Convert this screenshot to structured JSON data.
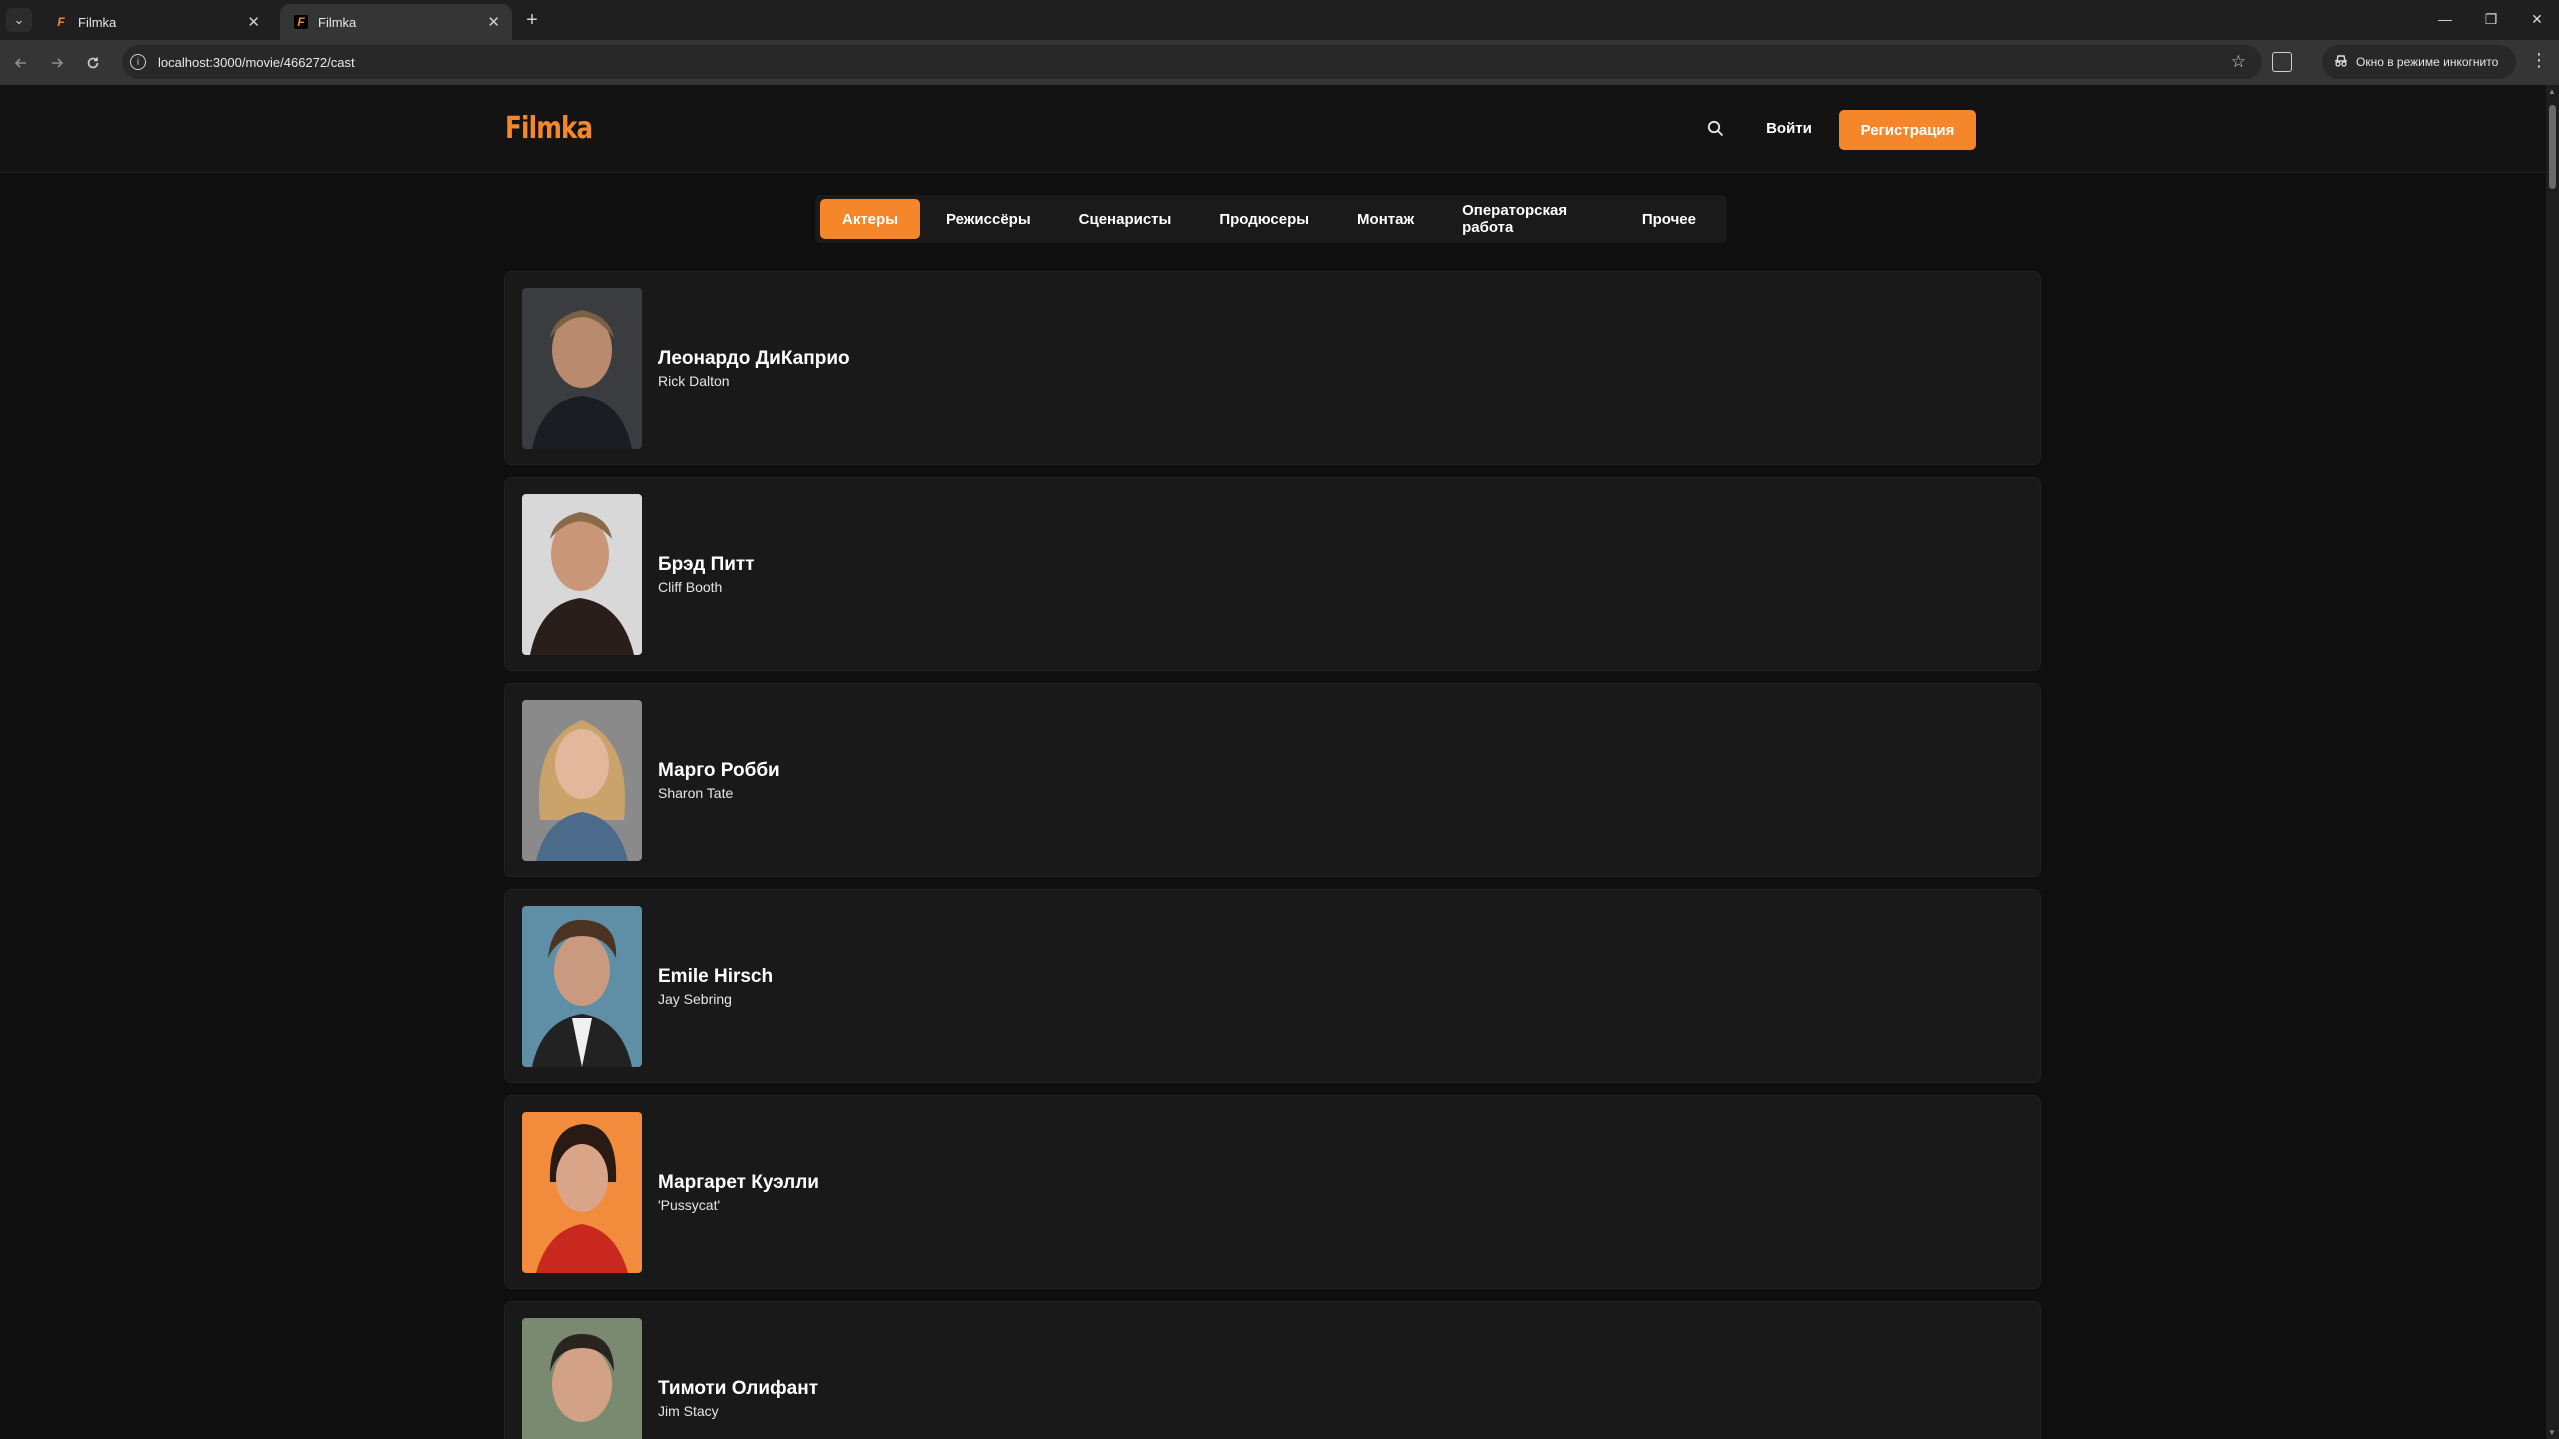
{
  "browser": {
    "tabs": [
      {
        "title": "Filmka",
        "favicon": "F",
        "active": false
      },
      {
        "title": "Filmka",
        "favicon": "F",
        "active": true
      }
    ],
    "url": "localhost:3000/movie/466272/cast",
    "incognito_label": "Окно в режиме инкогнито",
    "new_tab_symbol": "+",
    "tab_list_symbol": "⌄",
    "close_symbol": "✕",
    "window_controls": {
      "minimize": "—",
      "restore": "❐",
      "close": "✕"
    },
    "icons": [
      "back-icon",
      "forward-icon",
      "reload-icon",
      "info-icon",
      "star-icon",
      "extensions-icon",
      "incognito-icon",
      "menu-icon"
    ]
  },
  "header": {
    "logo": "Filmka",
    "login_label": "Войти",
    "register_label": "Регистрация",
    "accent_color": "#f5872a"
  },
  "cast_tabs": [
    {
      "label": "Актеры",
      "active": true
    },
    {
      "label": "Режиссёры",
      "active": false
    },
    {
      "label": "Сценаристы",
      "active": false
    },
    {
      "label": "Продюсеры",
      "active": false
    },
    {
      "label": "Монтаж",
      "active": false
    },
    {
      "label": "Операторская работа",
      "active": false
    },
    {
      "label": "Прочее",
      "active": false
    }
  ],
  "cast": [
    {
      "name": "Леонардо ДиКаприо",
      "role": "Rick Dalton",
      "photo_bg": "#3a3c40"
    },
    {
      "name": "Брэд Питт",
      "role": "Cliff Booth",
      "photo_bg": "#d8d8d8"
    },
    {
      "name": "Марго Робби",
      "role": "Sharon Tate",
      "photo_bg": "#8a8a8a"
    },
    {
      "name": "Emile Hirsch",
      "role": "Jay Sebring",
      "photo_bg": "#5f8fa6"
    },
    {
      "name": "Маргарет Куэлли",
      "role": "'Pussycat'",
      "photo_bg": "#f28b3c"
    },
    {
      "name": "Тимоти Олифант",
      "role": "Jim Stacy",
      "photo_bg": "#7a8a70"
    }
  ]
}
